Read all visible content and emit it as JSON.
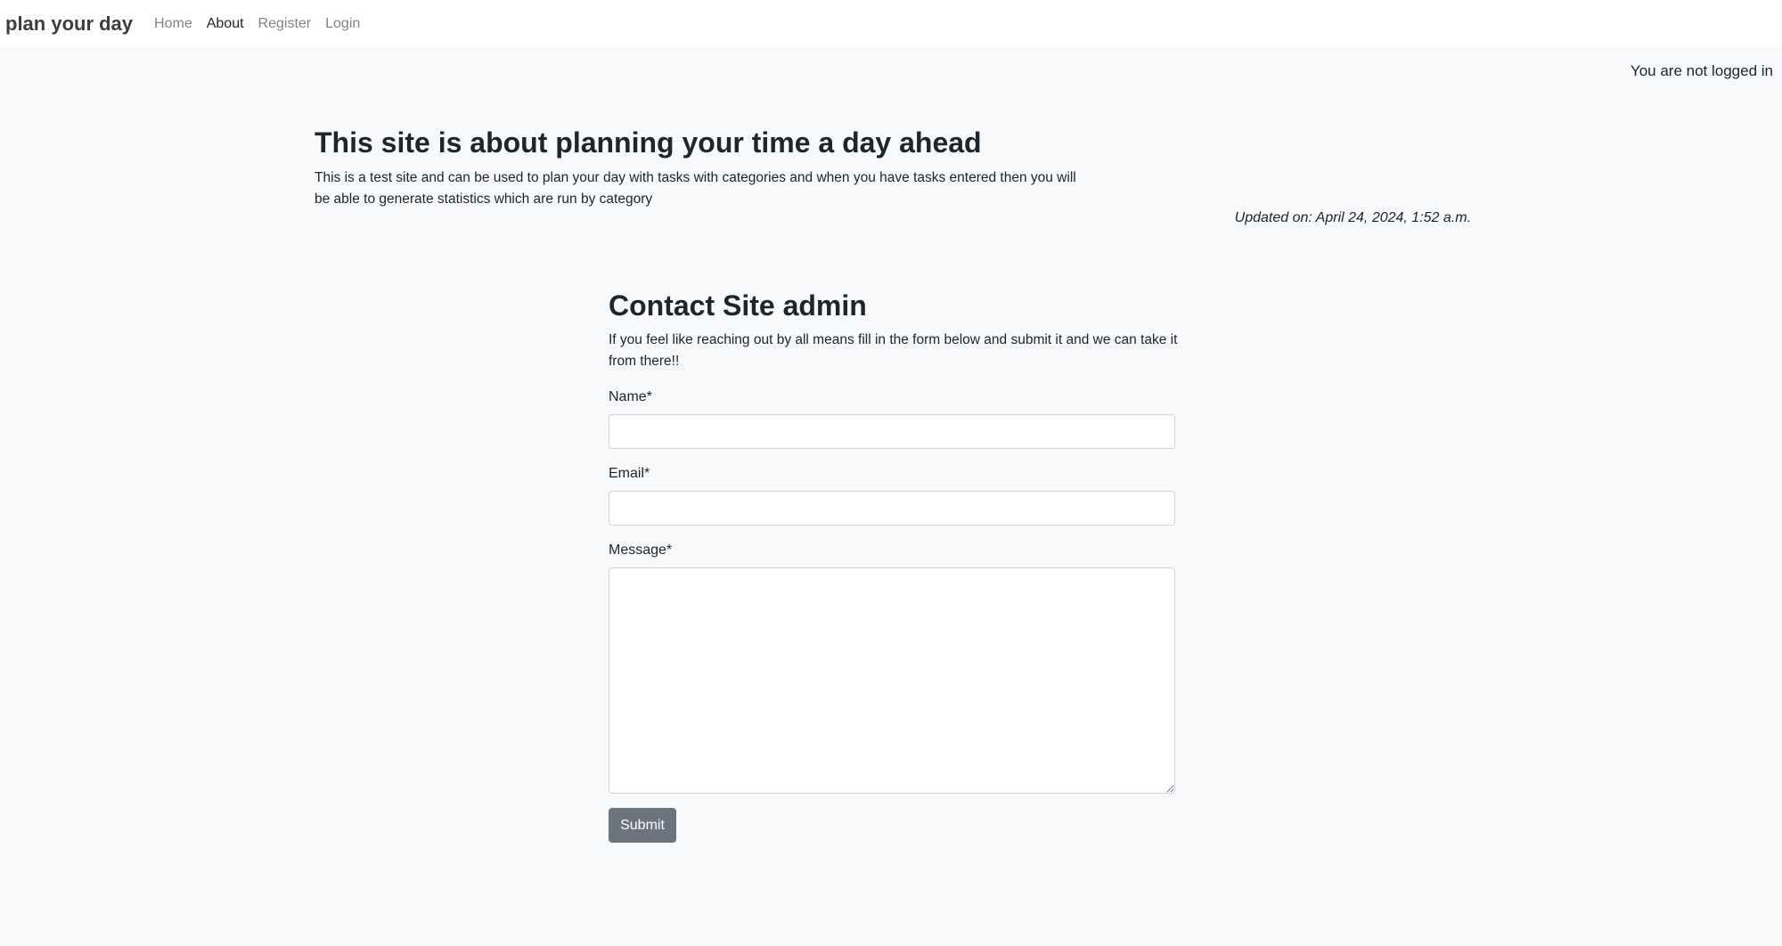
{
  "navbar": {
    "brand": "plan your day",
    "links": [
      {
        "label": "Home"
      },
      {
        "label": "About"
      },
      {
        "label": "Register"
      },
      {
        "label": "Login"
      }
    ]
  },
  "status": {
    "login": "You are not logged in"
  },
  "about": {
    "title": "This site is about planning your time a day ahead",
    "text": "This is a test site and can be used to plan your day with tasks with categories and when you have tasks entered then you will be able to generate statistics which are run by category",
    "updated": "Updated on: April 24, 2024, 1:52 a.m."
  },
  "contact": {
    "title": "Contact Site admin",
    "text": "If you feel like reaching out by all means fill in the form below and submit it and we can take it from there!!",
    "name_label": "Name*",
    "name_value": "",
    "email_label": "Email*",
    "email_value": "",
    "message_label": "Message*",
    "message_value": "",
    "submit_label": "Submit"
  },
  "colors": {
    "page_background": "#f8f9fa",
    "navbar_background": "#ffffff",
    "submit_button": "#6c757d"
  }
}
